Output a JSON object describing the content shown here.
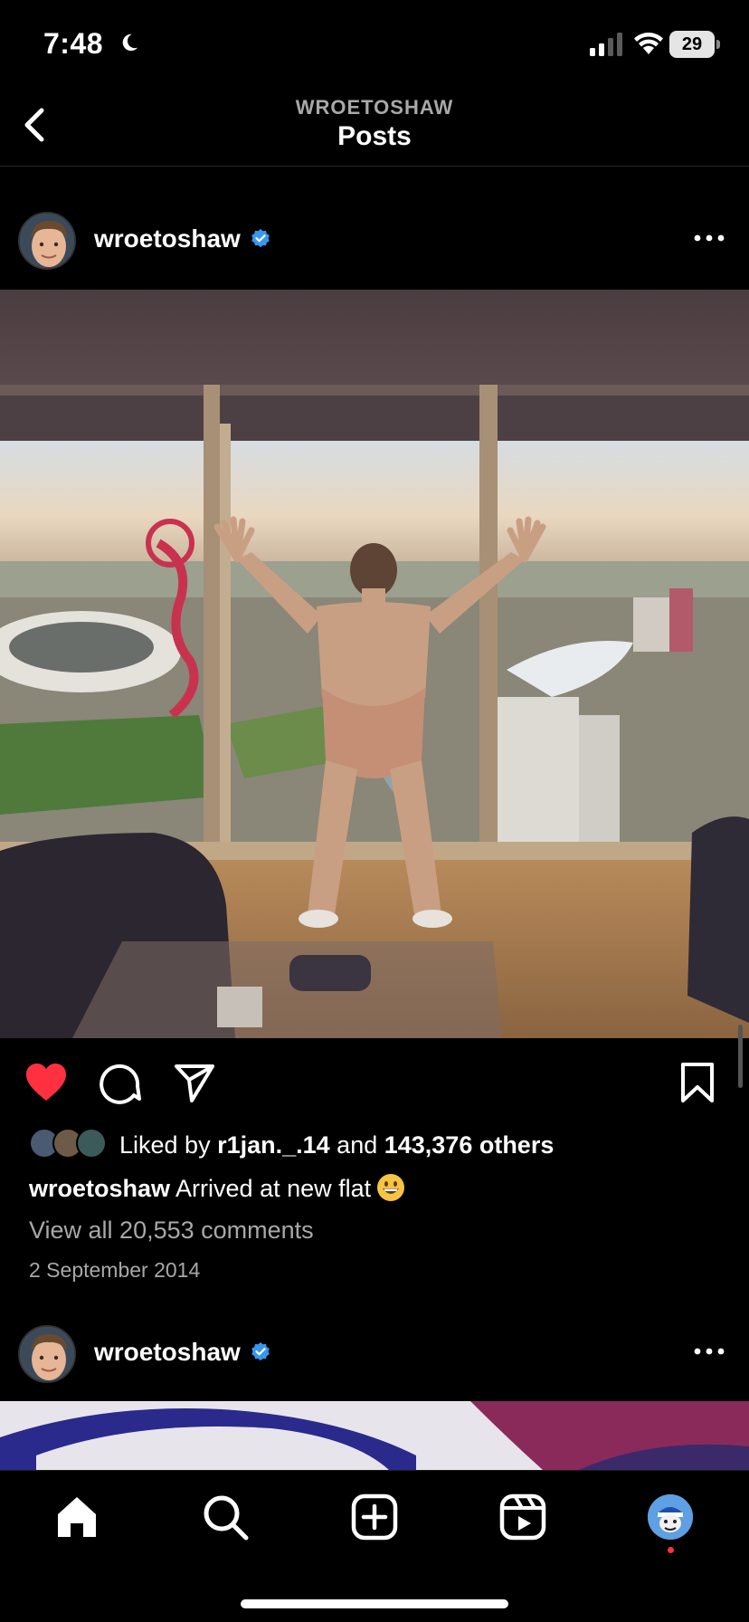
{
  "status": {
    "time": "7:48",
    "battery": "29"
  },
  "nav": {
    "account": "WROETOSHAW",
    "title": "Posts"
  },
  "post": {
    "username": "wroetoshaw",
    "liked_by_prefix": "Liked by ",
    "liked_by_user": "r1jan._.14",
    "liked_by_middle": " and ",
    "liked_by_count": "143,376 others",
    "caption_user": "wroetoshaw",
    "caption_text": "Arrived at new flat",
    "caption_emoji": "grinning-face-emoji",
    "comments_link": "View all 20,553 comments",
    "date": "2 September 2014",
    "liked": true
  },
  "next_post": {
    "username": "wroetoshaw"
  },
  "icons": {
    "back": "chevron-left-icon",
    "verified": "verified-badge-icon",
    "more": "more-horizontal-icon",
    "like": "heart-filled-icon",
    "comment": "comment-icon",
    "share": "send-icon",
    "save": "bookmark-icon",
    "home": "home-icon",
    "search": "search-icon",
    "create": "plus-square-icon",
    "reels": "reels-icon",
    "profile": "profile-avatar"
  },
  "colors": {
    "background": "#000000",
    "like_red": "#ff3040",
    "verified_blue": "#3897f0",
    "muted_text": "#a8a8a8"
  }
}
